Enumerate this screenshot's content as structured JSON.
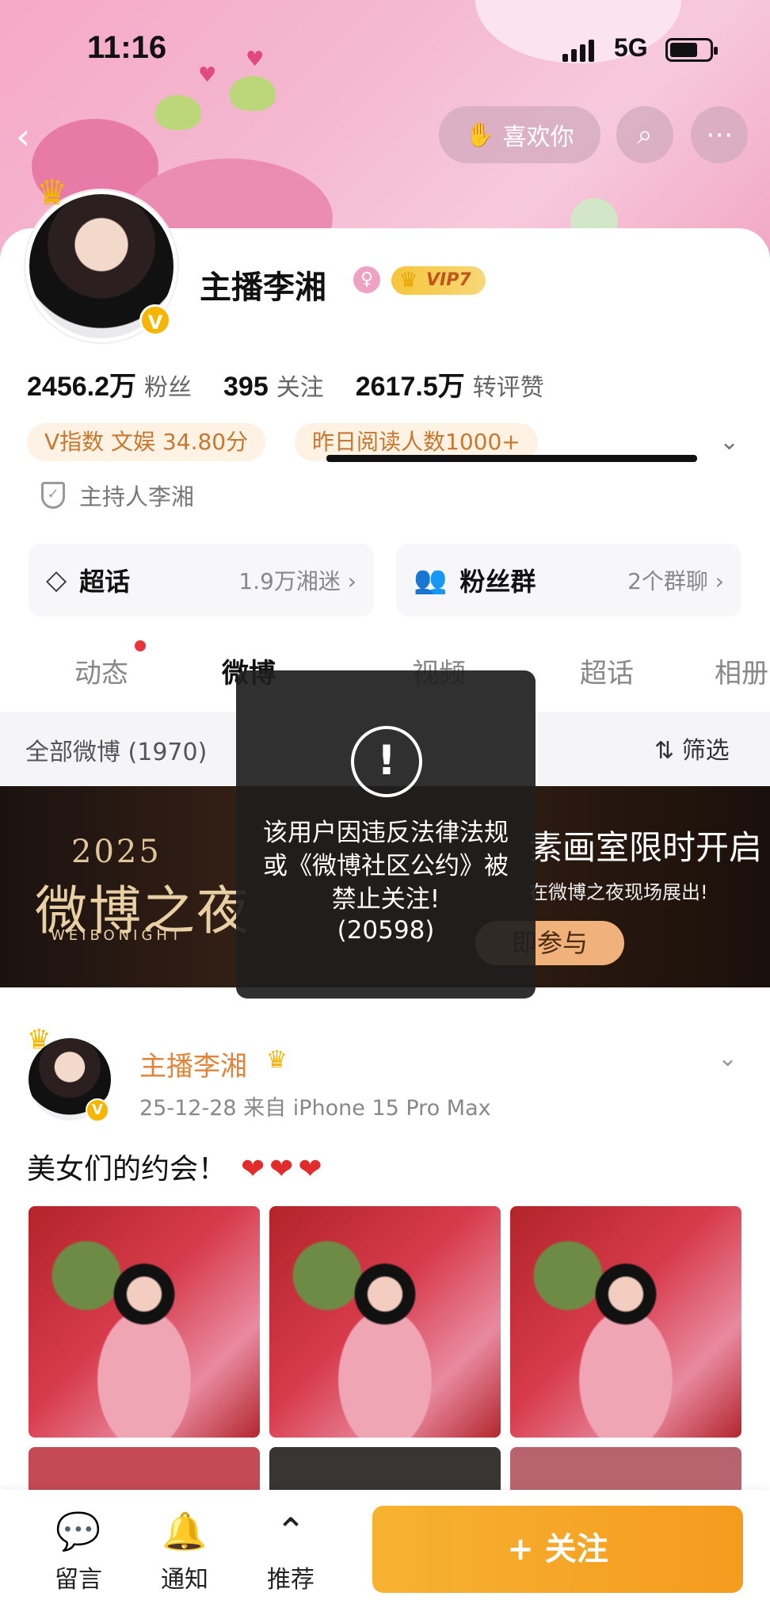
{
  "status_bar": {
    "time": "11:16",
    "network": "5G"
  },
  "header": {
    "like_label": "喜欢你"
  },
  "profile": {
    "name": "主播李湘",
    "vip_label": "VIP7",
    "stats": [
      {
        "num": "2456.2万",
        "label": "粉丝"
      },
      {
        "num": "395",
        "label": "关注"
      },
      {
        "num": "2617.5万",
        "label": "转评赞"
      }
    ],
    "chips": [
      "V指数 文娱 34.80分",
      "昨日阅读人数1000+"
    ],
    "host_label": "主持人李湘",
    "super_topic": {
      "title": "超话",
      "sub": "1.9万湘迷 ›"
    },
    "fan_group": {
      "title": "粉丝群",
      "sub": "2个群聊 ›"
    }
  },
  "tabs": [
    "动态",
    "微博",
    "视频",
    "超话",
    "相册"
  ],
  "filter_bar": {
    "all": "全部微博 (1970)",
    "filter": "筛选"
  },
  "ad": {
    "year": "2025",
    "title": "微博之夜",
    "en": "WEIBONIGHT",
    "right_title": "素画室限时开启",
    "right_sub": "在微博之夜现场展出!",
    "button": "即参与"
  },
  "toast": {
    "message": "该用户因违反法律法规或《微博社区公约》被禁止关注!",
    "code": "(20598)"
  },
  "post": {
    "author": "主播李湘",
    "meta": "25-12-28  来自 iPhone 15 Pro Max",
    "text": "美女们的约会！",
    "hearts": "❤❤❤"
  },
  "bottom_bar": {
    "items": [
      {
        "icon": "message-icon",
        "label": "留言"
      },
      {
        "icon": "bell-icon",
        "label": "通知"
      },
      {
        "icon": "up-icon",
        "label": "推荐"
      }
    ],
    "follow_label": "+ 关注"
  }
}
